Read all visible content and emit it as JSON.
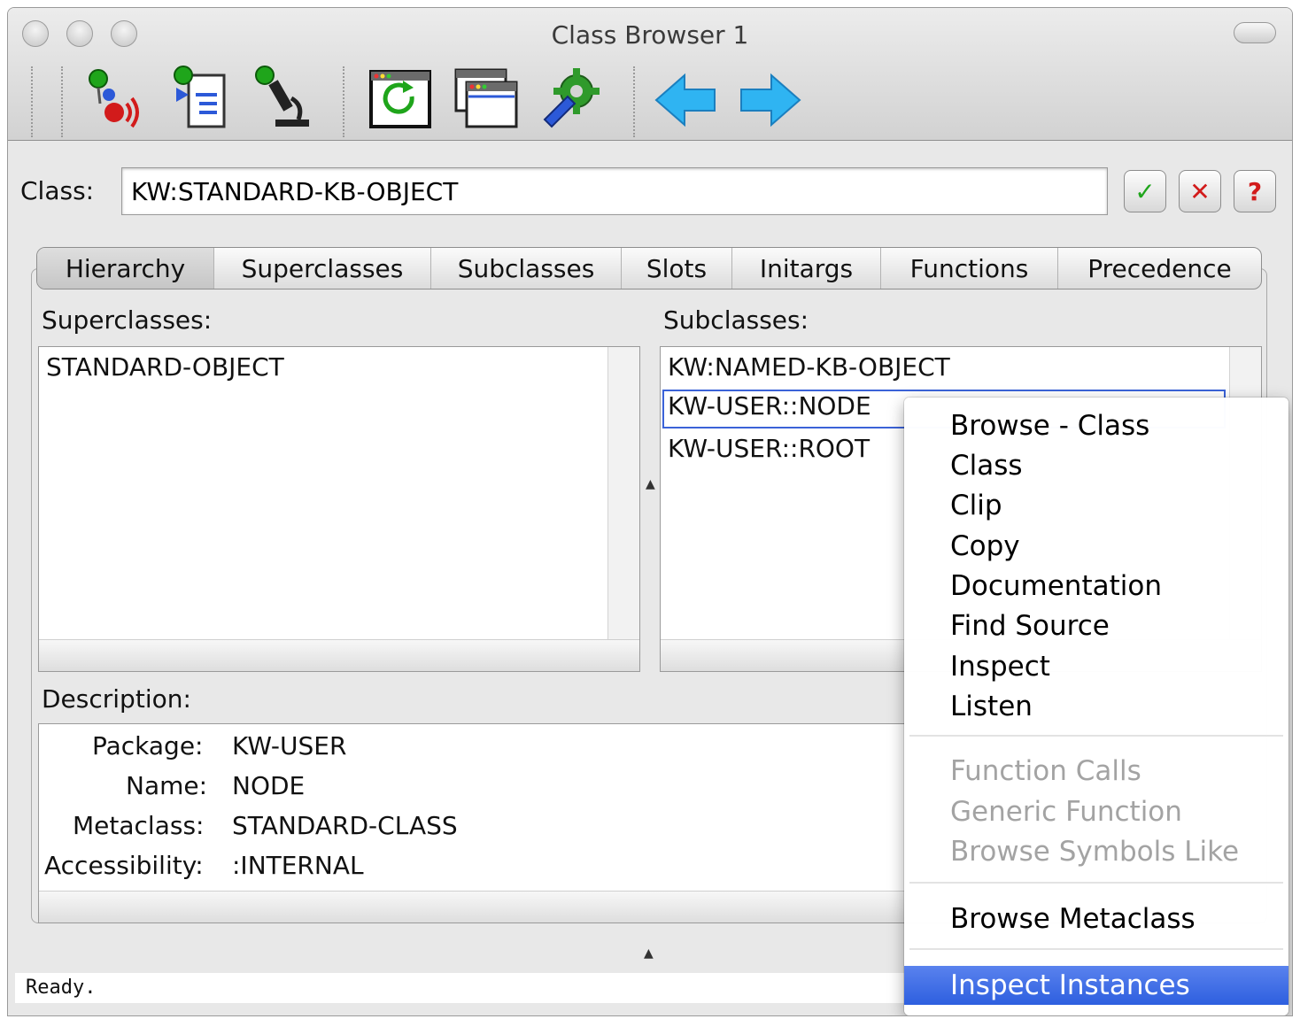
{
  "window": {
    "title": "Class Browser 1"
  },
  "toolbar": {
    "buttons": [
      {
        "name": "broadcast-tool-icon"
      },
      {
        "name": "document-tool-icon"
      },
      {
        "name": "microscope-tool-icon"
      },
      {
        "name": "refresh-window-icon"
      },
      {
        "name": "windows-icon"
      },
      {
        "name": "gear-wrench-icon"
      },
      {
        "name": "back-arrow-icon"
      },
      {
        "name": "forward-arrow-icon"
      }
    ],
    "colors": {
      "green": "#1fa51b",
      "red": "#d21b1b",
      "blue": "#2c59d8",
      "arrow": "#2fb4f2"
    }
  },
  "class_field": {
    "label": "Class:",
    "value": "KW:STANDARD-KB-OBJECT",
    "buttons": {
      "ok": "✓",
      "cancel": "✕",
      "help": "?"
    }
  },
  "tabs": [
    "Hierarchy",
    "Superclasses",
    "Subclasses",
    "Slots",
    "Initargs",
    "Functions",
    "Precedence"
  ],
  "superclasses": {
    "label": "Superclasses:",
    "items": [
      "STANDARD-OBJECT"
    ]
  },
  "subclasses": {
    "label": "Subclasses:",
    "items": [
      "KW:NAMED-KB-OBJECT",
      "KW-USER::NODE",
      "KW-USER::ROOT"
    ],
    "selected_index": 1
  },
  "description": {
    "label": "Description:",
    "rows": [
      {
        "key": "Package:",
        "value": "KW-USER"
      },
      {
        "key": "Name:",
        "value": "NODE"
      },
      {
        "key": "Metaclass:",
        "value": "STANDARD-CLASS"
      },
      {
        "key": "Accessibility:",
        "value": ":INTERNAL"
      }
    ]
  },
  "status": {
    "text": "Ready."
  },
  "context_menu": {
    "group1": [
      "Browse - Class",
      "Class",
      "Clip",
      "Copy",
      "Documentation",
      "Find Source",
      "Inspect",
      "Listen"
    ],
    "group2_disabled": [
      "Function Calls",
      "Generic Function",
      "Browse Symbols Like"
    ],
    "group3": [
      "Browse Metaclass"
    ],
    "group4": [
      "Inspect Instances"
    ],
    "highlighted": "Inspect Instances",
    "highlight_color": "#2e5fdf"
  }
}
